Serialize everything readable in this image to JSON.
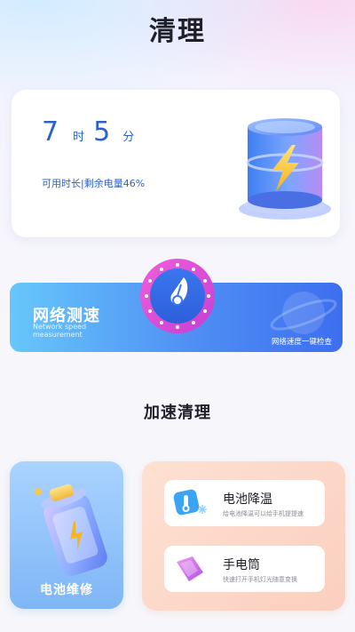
{
  "page": {
    "title": "清理"
  },
  "battery": {
    "hours": "7",
    "hours_unit": "时",
    "minutes": "5",
    "minutes_unit": "分",
    "description": "可用时长|剩余电量46%",
    "remaining_percent": 46
  },
  "network": {
    "title": "网络测速",
    "subtitle": "Network speed measurement",
    "tip": "网络速度一键检查"
  },
  "accelerate": {
    "title": "加速清理"
  },
  "repair": {
    "label": "电池维修"
  },
  "tools": [
    {
      "name": "电池降温",
      "desc": "给电池降温可以给手机提提速",
      "icon": "thermometer-icon"
    },
    {
      "name": "手电筒",
      "desc": "快速打开手机灯光随意变换",
      "icon": "flashlight-icon"
    }
  ],
  "colors": {
    "accent_blue": "#2a62c9",
    "net_gradient_start": "#67c7fb",
    "net_gradient_end": "#3d6eef",
    "gauge_pink": "#e64fd6",
    "tools_panel_bg": "#fde1d3"
  }
}
